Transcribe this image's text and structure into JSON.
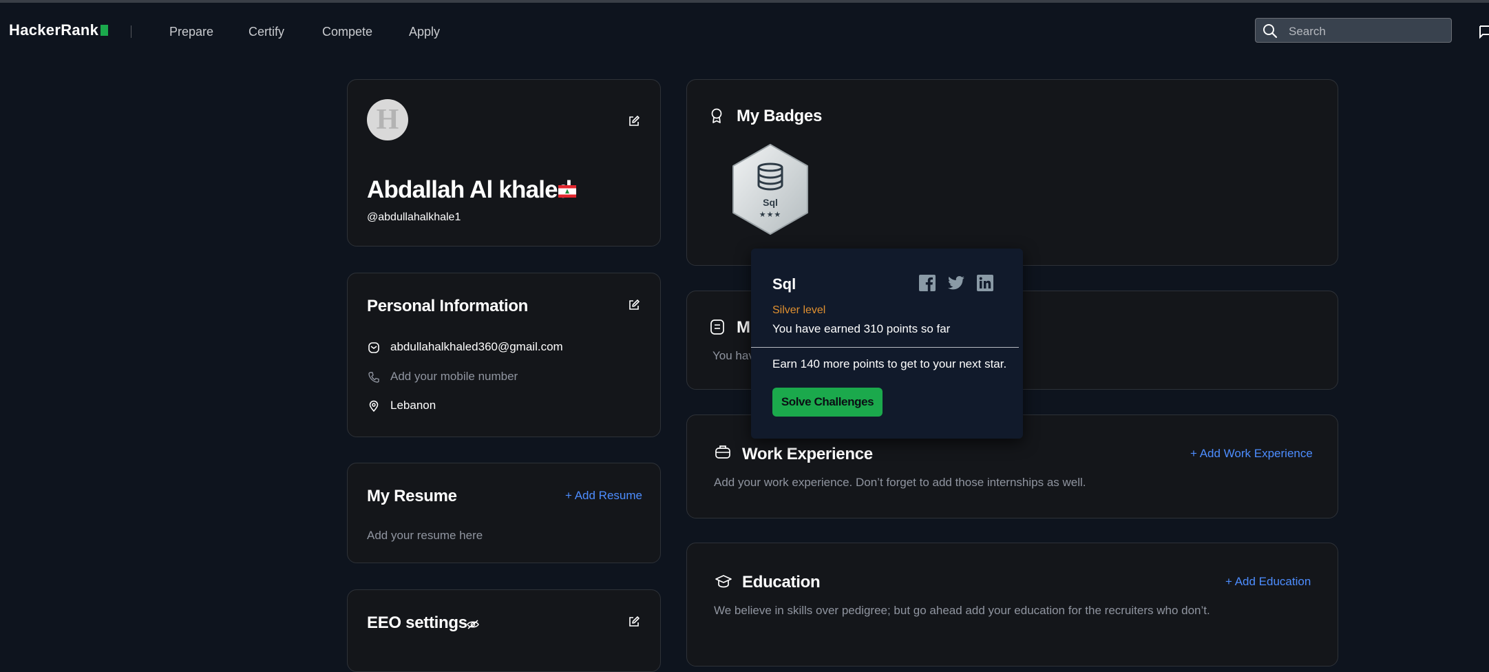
{
  "nav": {
    "logo": "HackerRank",
    "items": [
      "Prepare",
      "Certify",
      "Compete",
      "Apply"
    ],
    "search_placeholder": "Search"
  },
  "profile": {
    "name": "Abdallah Al khaled",
    "username": "@abdullahalkhale1",
    "avatar_letter": "H",
    "country_flag": "Lebanon"
  },
  "personal_info": {
    "title": "Personal Information",
    "email": "abdullahalkhaled360@gmail.com",
    "phone_placeholder": "Add your mobile number",
    "location": "Lebanon"
  },
  "resume": {
    "title": "My Resume",
    "add_label": "+ Add Resume",
    "placeholder": "Add your resume here"
  },
  "eeo": {
    "title": "EEO settings"
  },
  "badges": {
    "title": "My Badges",
    "items": [
      {
        "name": "Sql",
        "stars": "★★★"
      }
    ]
  },
  "certifications": {
    "title_partial": "M",
    "text_partial": "You hav"
  },
  "tooltip": {
    "title": "Sql",
    "level": "Silver level",
    "earned": "You have earned 310 points so far",
    "next": "Earn 140 more points to get to your next star.",
    "button": "Solve Challenges"
  },
  "work": {
    "title": "Work Experience",
    "add_label": "+ Add Work Experience",
    "text": "Add your work experience. Don’t forget to add those internships as well."
  },
  "education": {
    "title": "Education",
    "add_label": "+ Add Education",
    "text": "We believe in skills over pedigree; but go ahead add your education for the recruiters who don’t."
  },
  "colors": {
    "background": "#0e141e",
    "card": "#14161a",
    "accent_green": "#1ba94c",
    "link_blue": "#4d8dff",
    "silver_level": "#e09030"
  }
}
